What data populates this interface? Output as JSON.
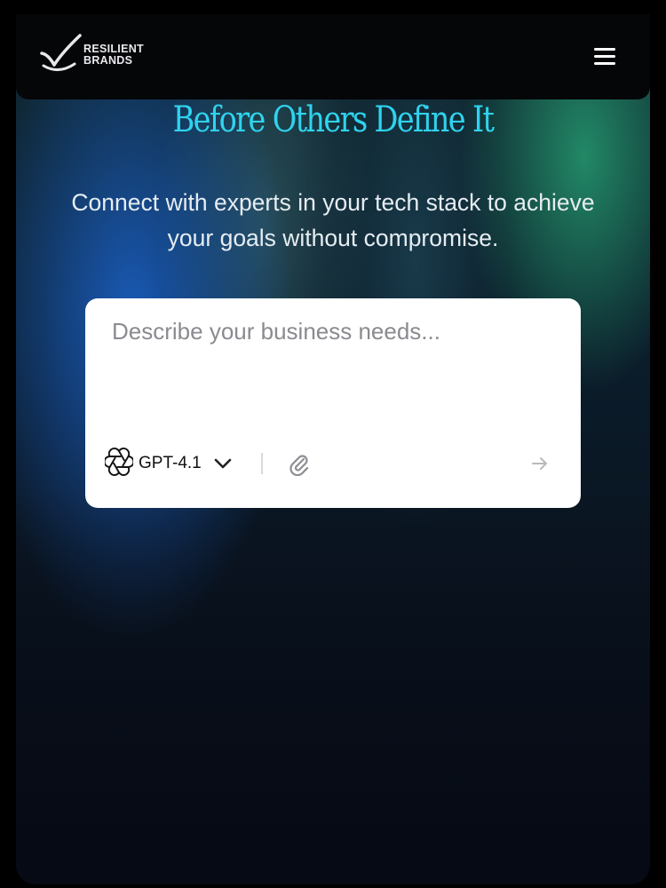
{
  "header": {
    "brand_line1": "RESILIENT",
    "brand_line2": "BRANDS",
    "logo_icon": "checkmark-swoosh-icon",
    "menu_icon": "hamburger-menu-icon"
  },
  "hero": {
    "headline": "Before Others Define It",
    "subtitle": "Connect with experts in your tech stack to achieve your goals without compromise.",
    "colors": {
      "headline": "#2fd3ee",
      "subtitle": "#e6edf2"
    }
  },
  "composer": {
    "placeholder": "Describe your business needs...",
    "model": {
      "label": "GPT-4.1",
      "icon": "openai-logo-icon",
      "dropdown_icon": "chevron-down-icon"
    },
    "attach_icon": "paperclip-icon",
    "send_icon": "arrow-right-icon"
  }
}
